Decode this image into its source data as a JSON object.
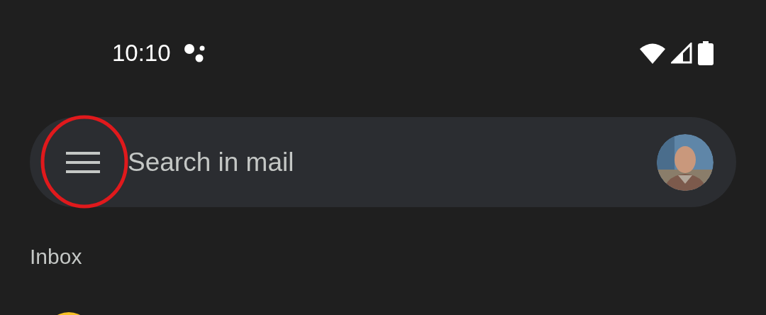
{
  "status_bar": {
    "time": "10:10"
  },
  "search": {
    "placeholder": "Search in mail"
  },
  "section_title": "Inbox"
}
